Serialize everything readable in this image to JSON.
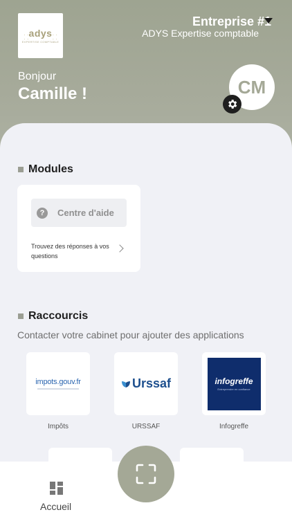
{
  "header": {
    "logo": {
      "word": "adys",
      "sub": "EXPERTISE COMPTABLE"
    },
    "company_name": "Entreprise #1",
    "company_sub": "ADYS Expertise comptable",
    "greeting": "Bonjour",
    "user_name": "Camille !",
    "avatar_initials": "CM"
  },
  "modules": {
    "title": "Modules",
    "help": {
      "label": "Centre d'aide",
      "description": "Trouvez des réponses à vos questions"
    }
  },
  "shortcuts": {
    "title": "Raccourcis",
    "hint": "Contacter votre cabinet pour ajouter des applications",
    "items": [
      {
        "label": "Impôts",
        "logo_text": "impots.gouv.fr"
      },
      {
        "label": "URSSAF",
        "logo_text": "Urssaf"
      },
      {
        "label": "Infogreffe",
        "logo_text": "infogreffe",
        "logo_tag": "Entreprendre en confiance"
      }
    ]
  },
  "nav": {
    "home_label": "Accueil"
  },
  "colors": {
    "accent": "#a4a896",
    "card": "#ffffff",
    "background": "#f0f1f6"
  }
}
